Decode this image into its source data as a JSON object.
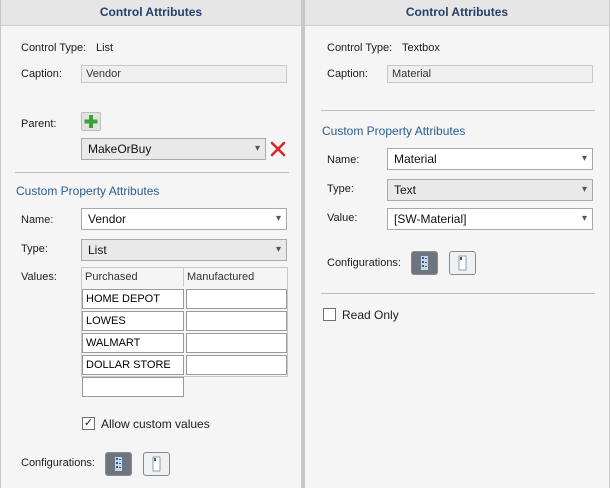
{
  "left": {
    "header": "Control Attributes",
    "control_type_label": "Control Type:",
    "control_type_value": "List",
    "caption_label": "Caption:",
    "caption_value": "Vendor",
    "parent_label": "Parent:",
    "parent_value": "MakeOrBuy",
    "section_title": "Custom Property Attributes",
    "name_label": "Name:",
    "name_value": "Vendor",
    "type_label": "Type:",
    "type_value": "List",
    "values_label": "Values:",
    "columns": [
      "Purchased",
      "Manufactured"
    ],
    "purchased_values": [
      "HOME DEPOT",
      "LOWES",
      "WALMART",
      "DOLLAR STORE",
      ""
    ],
    "allow_custom_label": "Allow custom values",
    "allow_custom_checked": true,
    "configurations_label": "Configurations:"
  },
  "right": {
    "header": "Control Attributes",
    "control_type_label": "Control Type:",
    "control_type_value": "Textbox",
    "caption_label": "Caption:",
    "caption_value": "Material",
    "section_title": "Custom Property Attributes",
    "name_label": "Name:",
    "name_value": "Material",
    "type_label": "Type:",
    "type_value": "Text",
    "value_label": "Value:",
    "value_value": "[SW-Material]",
    "configurations_label": "Configurations:",
    "read_only_label": "Read Only",
    "read_only_checked": false
  },
  "icons": {
    "chevron": "▾",
    "check": "✓"
  },
  "colors": {
    "accent": "#2b5d8e",
    "header_text": "#243f6b",
    "add_green": "#3aa23a",
    "delete_red": "#d9262a"
  }
}
